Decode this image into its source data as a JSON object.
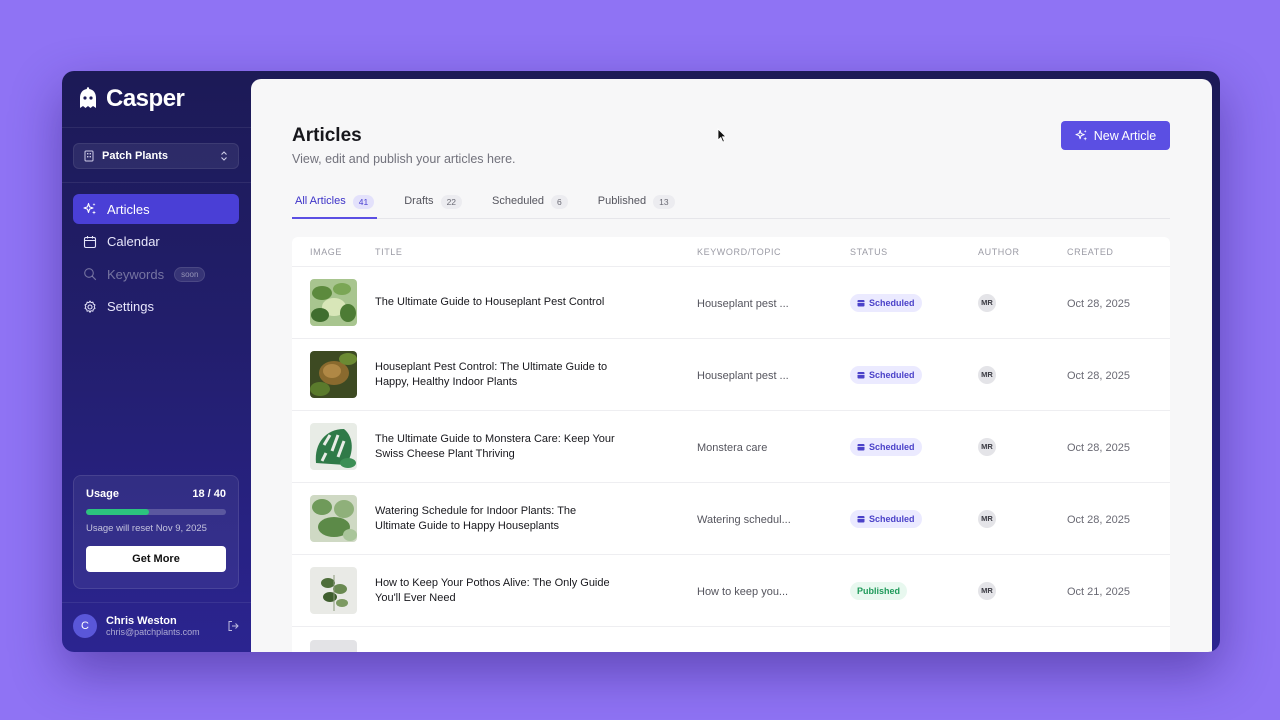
{
  "brand": {
    "name": "Casper"
  },
  "workspace": {
    "name": "Patch Plants"
  },
  "nav": {
    "articles": "Articles",
    "calendar": "Calendar",
    "keywords": "Keywords",
    "keywords_badge": "soon",
    "settings": "Settings"
  },
  "usage": {
    "label": "Usage",
    "count": "18 / 40",
    "used": 18,
    "limit": 40,
    "reset_text": "Usage will reset Nov 9, 2025",
    "button": "Get More"
  },
  "user": {
    "initial": "C",
    "name": "Chris Weston",
    "email": "chris@patchplants.com"
  },
  "header": {
    "title": "Articles",
    "subtitle": "View, edit and publish your articles here.",
    "new_button": "New Article"
  },
  "tabs": [
    {
      "label": "All Articles",
      "count": "41"
    },
    {
      "label": "Drafts",
      "count": "22"
    },
    {
      "label": "Scheduled",
      "count": "6"
    },
    {
      "label": "Published",
      "count": "13"
    }
  ],
  "table": {
    "columns": [
      "IMAGE",
      "TITLE",
      "KEYWORD/TOPIC",
      "STATUS",
      "AUTHOR",
      "CREATED"
    ],
    "rows": [
      {
        "title": "The Ultimate Guide to Houseplant Pest Control",
        "keyword": "Houseplant pest ...",
        "status": "Scheduled",
        "author": "MR",
        "created": "Oct 28, 2025"
      },
      {
        "title": "Houseplant Pest Control: The Ultimate Guide to Happy, Healthy Indoor Plants",
        "keyword": "Houseplant pest ...",
        "status": "Scheduled",
        "author": "MR",
        "created": "Oct 28, 2025"
      },
      {
        "title": "The Ultimate Guide to Monstera Care: Keep Your Swiss Cheese Plant Thriving",
        "keyword": "Monstera care",
        "status": "Scheduled",
        "author": "MR",
        "created": "Oct 28, 2025"
      },
      {
        "title": "Watering Schedule for Indoor Plants: The Ultimate Guide to Happy Houseplants",
        "keyword": "Watering schedul...",
        "status": "Scheduled",
        "author": "MR",
        "created": "Oct 28, 2025"
      },
      {
        "title": "How to Keep Your Pothos Alive: The Only Guide You'll Ever Need",
        "keyword": "How to keep you...",
        "status": "Published",
        "author": "MR",
        "created": "Oct 21, 2025"
      }
    ]
  },
  "colors": {
    "accent": "#5b4fe3",
    "sidebar": "#1c1a56",
    "scheduled": "#4b42c9",
    "published": "#1f9a5a",
    "usage_fill": "#2cc37e"
  }
}
